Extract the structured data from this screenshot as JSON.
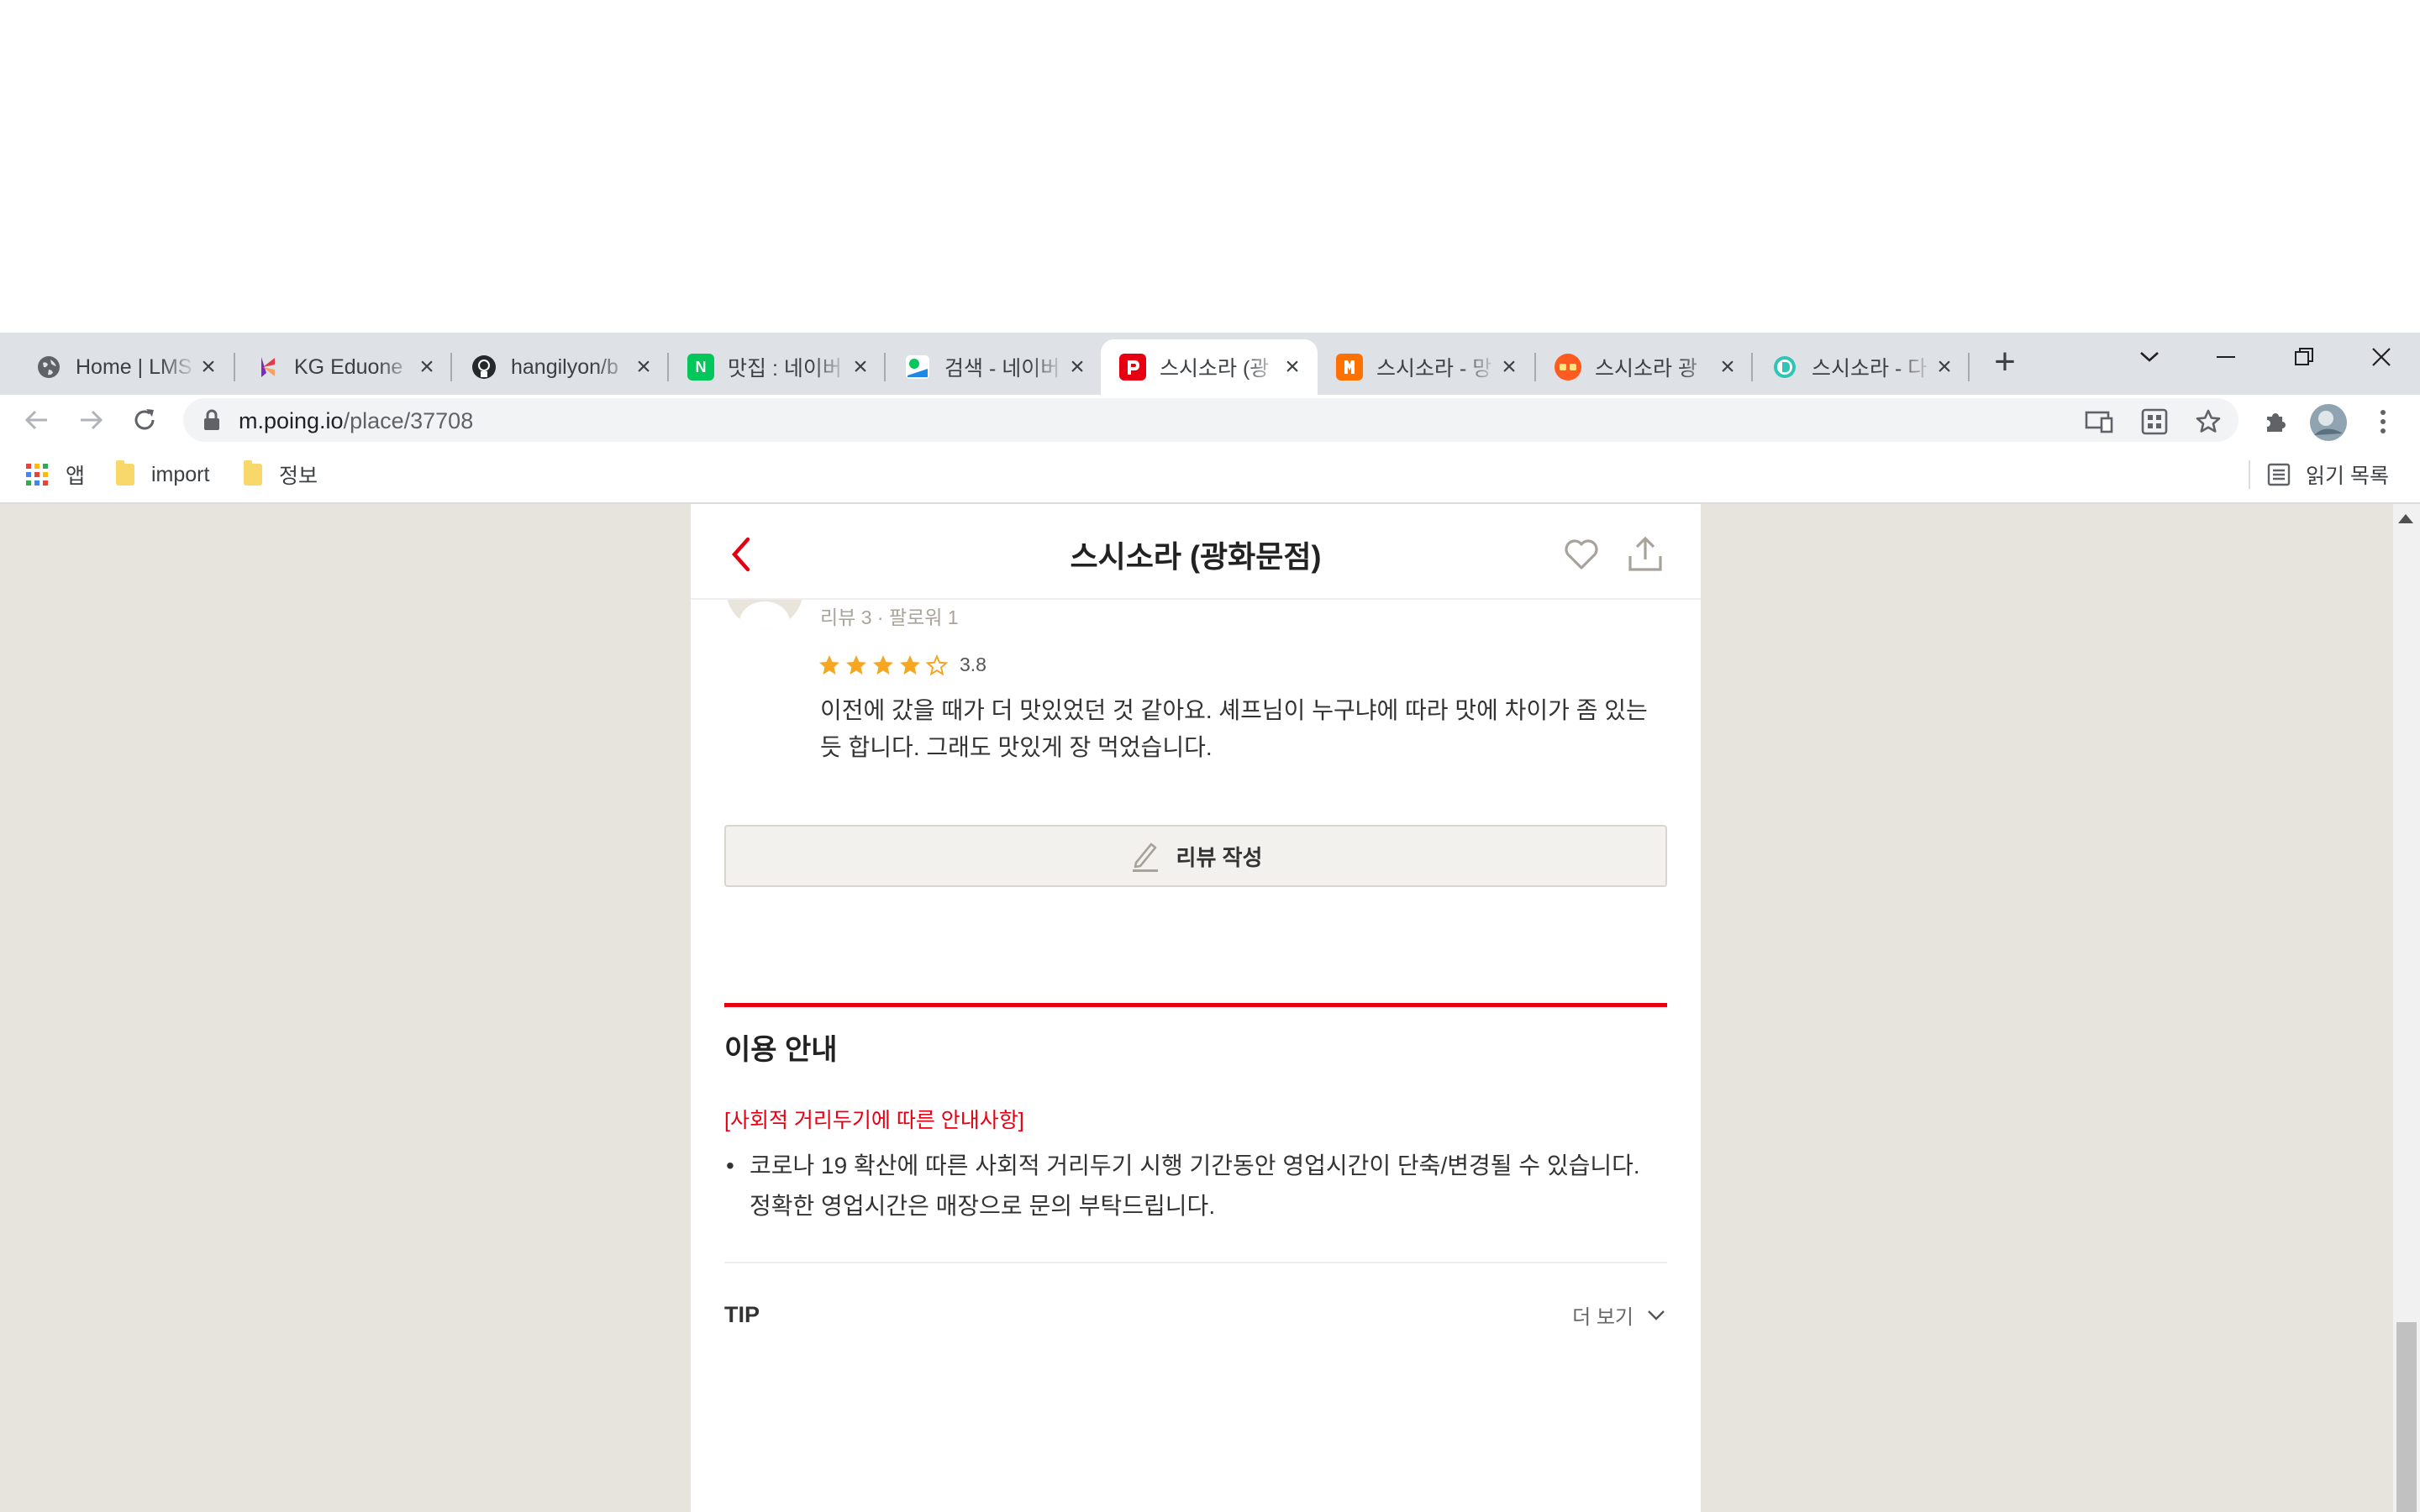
{
  "browser": {
    "tabs": [
      {
        "title": "Home | LMS",
        "favicon": "globe-icon",
        "active": false
      },
      {
        "title": "KG Eduone",
        "favicon": "kg-eduone-icon",
        "active": false
      },
      {
        "title": "hangilyon/b",
        "favicon": "github-icon",
        "active": false
      },
      {
        "title": "맛집 : 네이버",
        "favicon": "naver-n-icon",
        "active": false
      },
      {
        "title": "검색 - 네이버",
        "favicon": "naver-map-icon",
        "active": false
      },
      {
        "title": "스시소라 (광",
        "favicon": "poing-icon",
        "active": true
      },
      {
        "title": "스시소라 - 망",
        "favicon": "mangoplate-icon",
        "active": false
      },
      {
        "title": "스시소라 광",
        "favicon": "siksin-icon",
        "active": false
      },
      {
        "title": "스시소라 - 다",
        "favicon": "diningcode-icon",
        "active": false
      }
    ],
    "url_host": "m.poing.io",
    "url_path": "/place/37708",
    "bookmarks": {
      "apps": "앱",
      "import": "import",
      "info": "정보",
      "reading_list": "읽기 목록"
    }
  },
  "page": {
    "title": "스시소라 (광화문점)",
    "review": {
      "meta": "리뷰 3 · 팔로워 1",
      "rating": "3.8",
      "rating_value": 3.8,
      "text": "이전에 갔을 때가 더 맛있었던 것 같아요. 셰프님이 누구냐에 따라 맛에 차이가 좀 있는 듯 합니다. 그래도 맛있게 장 먹었습니다."
    },
    "write_review_label": "리뷰 작성",
    "info": {
      "title": "이용 안내",
      "notice_heading": "[사회적 거리두기에 따른 안내사항]",
      "bullet": "•",
      "notice_line1": "코로나 19 확산에 따른 사회적 거리두기 시행 기간동안 영업시간이 단축/변경될 수 있습니다.",
      "notice_line2": "정확한 영업시간은 매장으로 문의 부탁드립니다."
    },
    "tip": {
      "label": "TIP",
      "more_label": "더 보기"
    }
  },
  "colors": {
    "brand_red": "#e60012",
    "star": "#f5a623",
    "page_bg": "#e7e4de"
  }
}
